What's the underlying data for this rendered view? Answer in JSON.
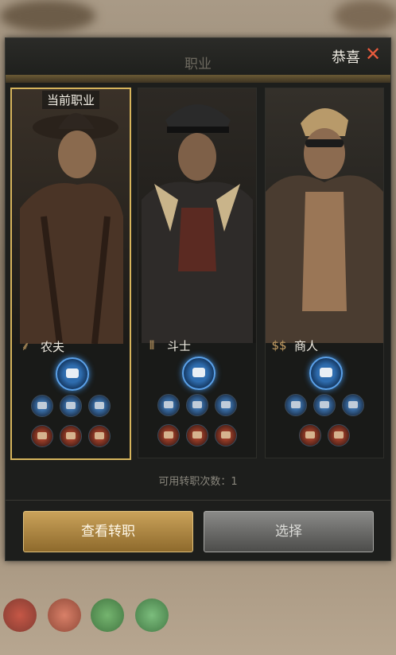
{
  "header": {
    "title": "职业",
    "notice": "恭喜"
  },
  "current_tag": "当前职业",
  "cards": [
    {
      "name": "农夫",
      "icon": "wheat-icon",
      "selected": true
    },
    {
      "name": "斗士",
      "icon": "bullets-icon",
      "selected": false
    },
    {
      "name": "商人",
      "icon": "money-icon",
      "selected": false
    }
  ],
  "transfer_count": "可用转职次数：1",
  "buttons": {
    "view": "查看转职",
    "select": "选择"
  },
  "colors": {
    "accent_gold": "#d6b45c",
    "skill_blue": "#3d8ad8",
    "skill_red": "#9a3d28"
  }
}
